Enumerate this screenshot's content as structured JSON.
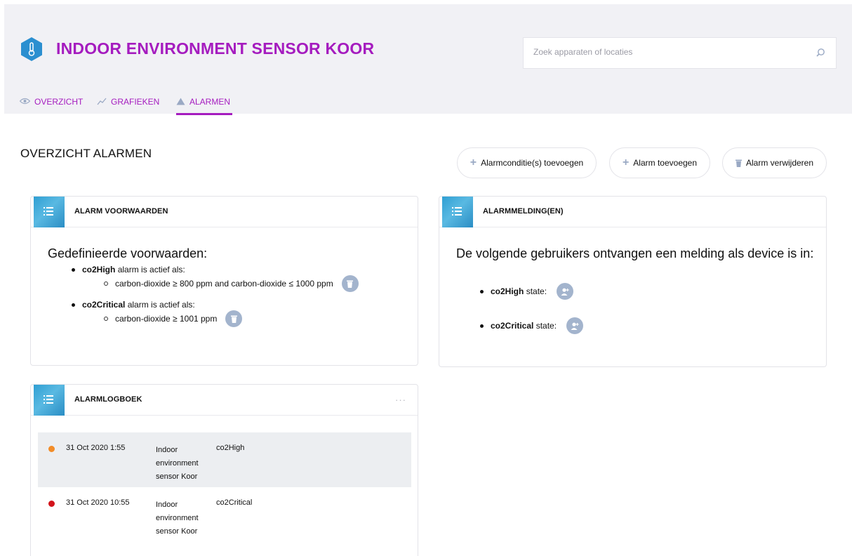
{
  "header": {
    "title": "INDOOR ENVIRONMENT SENSOR KOOR",
    "device_icon": "thermometer-icon",
    "brand_color": "#a51cbf",
    "icon_color": "#2b8fd0"
  },
  "search": {
    "placeholder": "Zoek apparaten of locaties",
    "value": ""
  },
  "tabs": [
    {
      "label": "OVERZICHT",
      "icon": "eye-icon"
    },
    {
      "label": "GRAFIEKEN",
      "icon": "chart-line-icon"
    },
    {
      "label": "ALARMEN",
      "icon": "warning-icon",
      "active": true
    }
  ],
  "page": {
    "section_title": "OVERZICHT ALARMEN"
  },
  "actions": {
    "add_condition": "Alarmconditie(s) toevoegen",
    "add_alarm": "Alarm toevoegen",
    "remove_alarm": "Alarm verwijderen"
  },
  "conditions_card": {
    "title": "ALARM VOORWAARDEN",
    "heading": "Gedefinieerde voorwaarden:",
    "alarms": [
      {
        "name": "co2High",
        "suffix": "alarm is actief als:",
        "condition": "carbon-dioxide ≥ 800 ppm and carbon-dioxide ≤ 1000 ppm"
      },
      {
        "name": "co2Critical",
        "suffix": "alarm is actief als:",
        "condition": "carbon-dioxide ≥ 1001 ppm"
      }
    ]
  },
  "notifications_card": {
    "title": "ALARMMELDING(EN)",
    "heading": "De volgende gebruikers ontvangen een melding als device is in:",
    "states": [
      {
        "name": "co2High",
        "suffix": "state:"
      },
      {
        "name": "co2Critical",
        "suffix": "state:"
      }
    ]
  },
  "log_card": {
    "title": "ALARMLOGBOEK",
    "more": "···",
    "entries": [
      {
        "date": "31 Oct 2020 1:55",
        "device": "Indoor environment sensor Koor",
        "alarm": "co2High",
        "status_color": "#f28c28"
      },
      {
        "date": "31 Oct 2020 10:55",
        "device": "Indoor environment sensor Koor",
        "alarm": "co2Critical",
        "status_color": "#d3141b"
      }
    ]
  }
}
